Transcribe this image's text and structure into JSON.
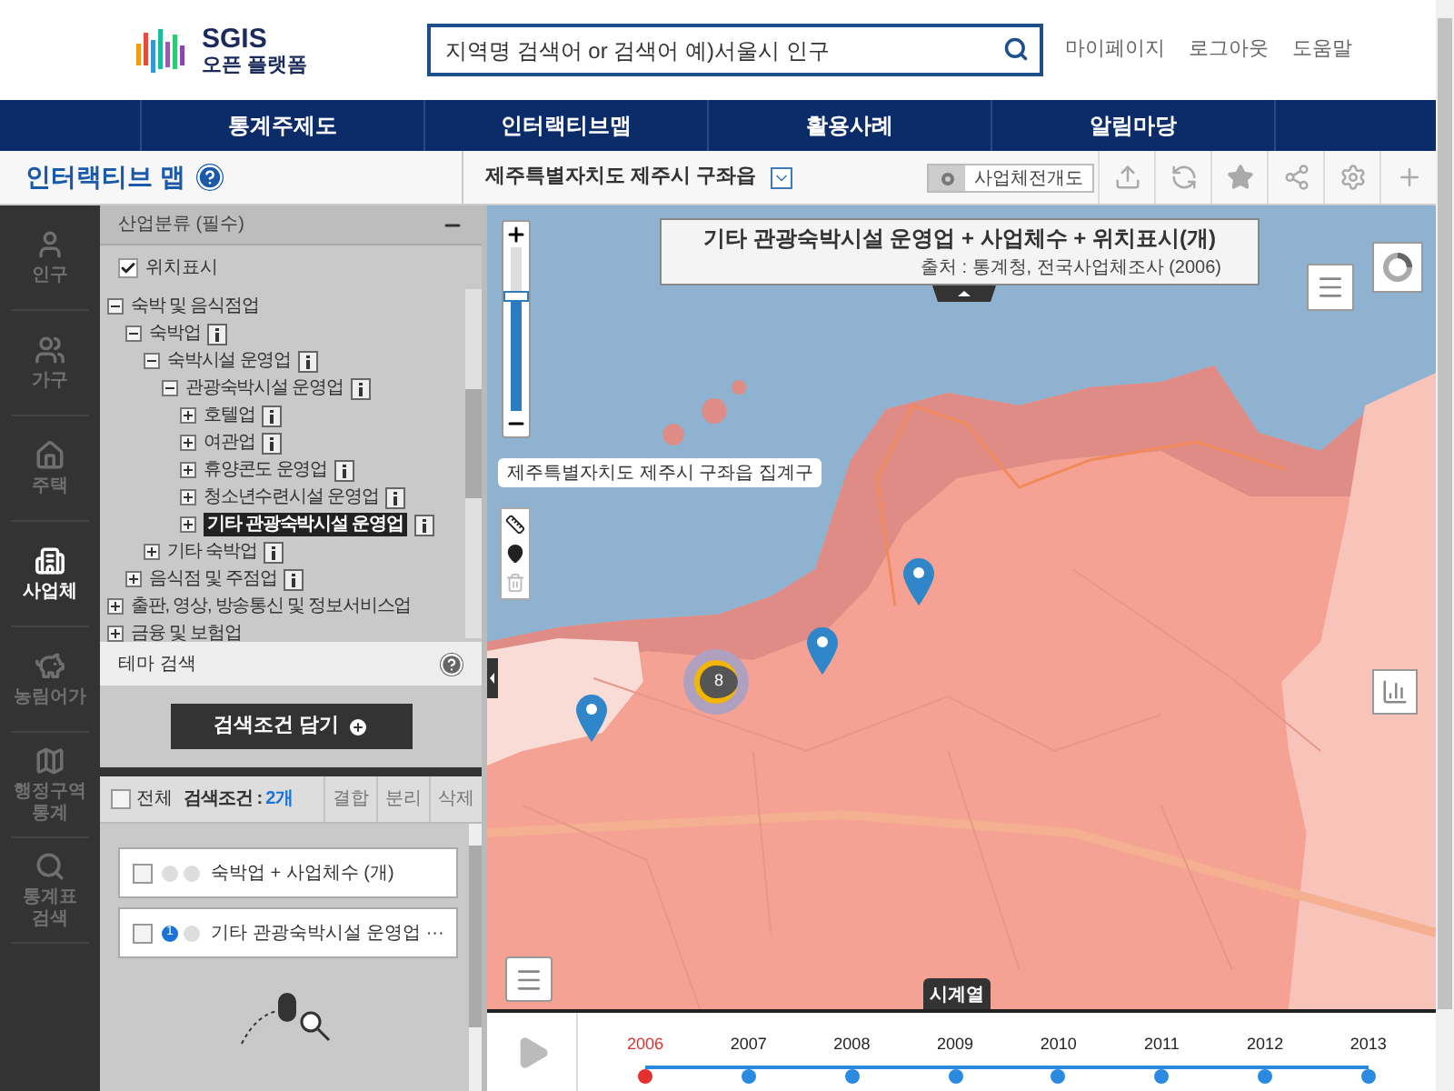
{
  "header": {
    "logo_title": "SGIS",
    "logo_subtitle": "오픈 플랫폼",
    "search": {
      "placeholder": "지역명 검색어 or 검색어 예)서울시 인구"
    },
    "links": [
      "마이페이지",
      "로그아웃",
      "도움말"
    ]
  },
  "nav": [
    {
      "label": "통계주제도"
    },
    {
      "label": "인터랙티브맵"
    },
    {
      "label": "활용사례"
    },
    {
      "label": "알림마당"
    }
  ],
  "page_title": "인터랙티브 맵",
  "region": "제주특별자치도 제주시 구좌읍",
  "toggle": {
    "label": "사업체전개도",
    "on": false
  },
  "rail": [
    {
      "label": "인구",
      "kind": "person",
      "selected": false
    },
    {
      "label": "가구",
      "kind": "family",
      "selected": false
    },
    {
      "label": "주택",
      "kind": "house",
      "selected": false
    },
    {
      "label": "사업체",
      "kind": "building",
      "selected": true
    },
    {
      "label": "농림어가",
      "kind": "pig",
      "selected": false
    },
    {
      "label": "행정구역 통계",
      "kind": "map",
      "selected": false
    },
    {
      "label": "통계표 검색",
      "kind": "search",
      "selected": false
    }
  ],
  "panel": {
    "section_title": "산업분류 (필수)",
    "location": {
      "label": "위치표시",
      "checked": true
    },
    "tree": [
      {
        "label": "숙박 및 음식점업",
        "expanded": true,
        "info": false,
        "selected": false,
        "children": [
          {
            "label": "숙박업",
            "expanded": true,
            "info": true,
            "selected": false,
            "children": [
              {
                "label": "숙박시설 운영업",
                "expanded": true,
                "info": true,
                "selected": false,
                "children": [
                  {
                    "label": "관광숙박시설 운영업",
                    "expanded": true,
                    "info": true,
                    "selected": false,
                    "children": [
                      {
                        "label": "호텔업",
                        "expanded": false,
                        "info": true,
                        "selected": false
                      },
                      {
                        "label": "여관업",
                        "expanded": false,
                        "info": true,
                        "selected": false
                      },
                      {
                        "label": "휴양콘도 운영업",
                        "expanded": false,
                        "info": true,
                        "selected": false
                      },
                      {
                        "label": "청소년수련시설 운영업",
                        "expanded": false,
                        "info": true,
                        "selected": false
                      },
                      {
                        "label": "기타 관광숙박시설 운영업",
                        "expanded": false,
                        "info": true,
                        "selected": true
                      }
                    ]
                  }
                ]
              },
              {
                "label": "기타 숙박업",
                "expanded": false,
                "info": true,
                "selected": false
              }
            ]
          },
          {
            "label": "음식점 및 주점업",
            "expanded": false,
            "info": true,
            "selected": false
          }
        ]
      },
      {
        "label": "출판, 영상, 방송통신 및 정보서비스업",
        "expanded": false,
        "info": false,
        "selected": false
      },
      {
        "label": "금융 및 보험업",
        "expanded": false,
        "info": false,
        "selected": false
      }
    ],
    "theme_search": "테마 검색",
    "add_button": "검색조건 담기"
  },
  "conditions": {
    "all_label": "전체",
    "all_checked": false,
    "count_label": "검색조건 :",
    "count": "2개",
    "actions": [
      "결합",
      "분리",
      "삭제"
    ],
    "items": [
      {
        "label": "숙박업 + 사업체수 (개)",
        "checked": false
      },
      {
        "label": "기타 관광숙박시설 운영업 ···",
        "checked": false,
        "map_number": "1"
      }
    ]
  },
  "map": {
    "title": "기타 관광숙박시설 운영업 + 사업체수 + 위치표시(개)",
    "source": "출처 : 통계청, 전국사업체조사 (2006)",
    "zoom": {
      "level": 0.7
    },
    "tooltip": "제주특별자치도 제주시 구좌읍 집계구",
    "cluster": "8",
    "timeline_tab": "시계열"
  },
  "timeline": [
    {
      "year": "2006",
      "selected": true
    },
    {
      "year": "2007",
      "selected": false
    },
    {
      "year": "2008",
      "selected": false
    },
    {
      "year": "2009",
      "selected": false
    },
    {
      "year": "2010",
      "selected": false
    },
    {
      "year": "2011",
      "selected": false
    },
    {
      "year": "2012",
      "selected": false
    },
    {
      "year": "2013",
      "selected": false
    }
  ]
}
